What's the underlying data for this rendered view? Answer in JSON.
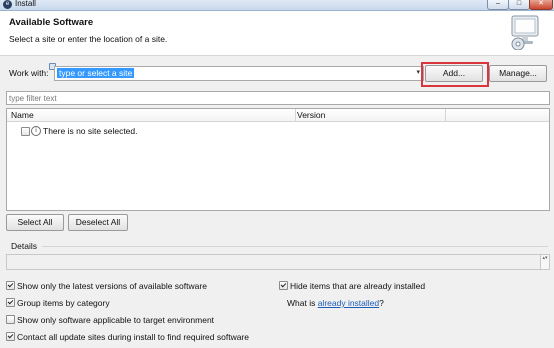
{
  "window": {
    "title": "Install",
    "app_icon_glyph": "e",
    "controls": {
      "minimize": "–",
      "maximize": "□",
      "close": "✕"
    }
  },
  "header": {
    "title": "Available Software",
    "subtitle": "Select a site or enter the location of a site.",
    "icon": "monitor-install-icon"
  },
  "work_with": {
    "label": "Work with:",
    "value": "type or select a site",
    "dropdown_glyph": "▾",
    "add_button": "Add...",
    "manage_button": "Manage..."
  },
  "filter": {
    "placeholder": "type filter text",
    "value": ""
  },
  "table": {
    "columns": [
      "Name",
      "Version"
    ],
    "rows": [
      {
        "text": "There is no site selected.",
        "checked": false,
        "icon": "info-icon"
      }
    ]
  },
  "selection_buttons": {
    "select_all": "Select All",
    "deselect_all": "Deselect All"
  },
  "details": {
    "label": "Details",
    "scroll_glyph": "▴▾"
  },
  "options": {
    "latest_versions": {
      "label": "Show only the latest versions of available software",
      "checked": true
    },
    "group_by_category": {
      "label": "Group items by category",
      "checked": true
    },
    "target_env": {
      "label": "Show only software applicable to target environment",
      "checked": false
    },
    "contact_sites": {
      "label": "Contact all update sites during install to find required software",
      "checked": true
    },
    "hide_installed": {
      "label": "Hide items that are already installed",
      "checked": true
    },
    "what_is_prefix": "What is ",
    "already_installed_link": "already installed",
    "what_is_suffix": "?"
  },
  "colors": {
    "selection": "#3399ff",
    "highlight_border": "#d9363e",
    "link": "#1f5cb8"
  }
}
